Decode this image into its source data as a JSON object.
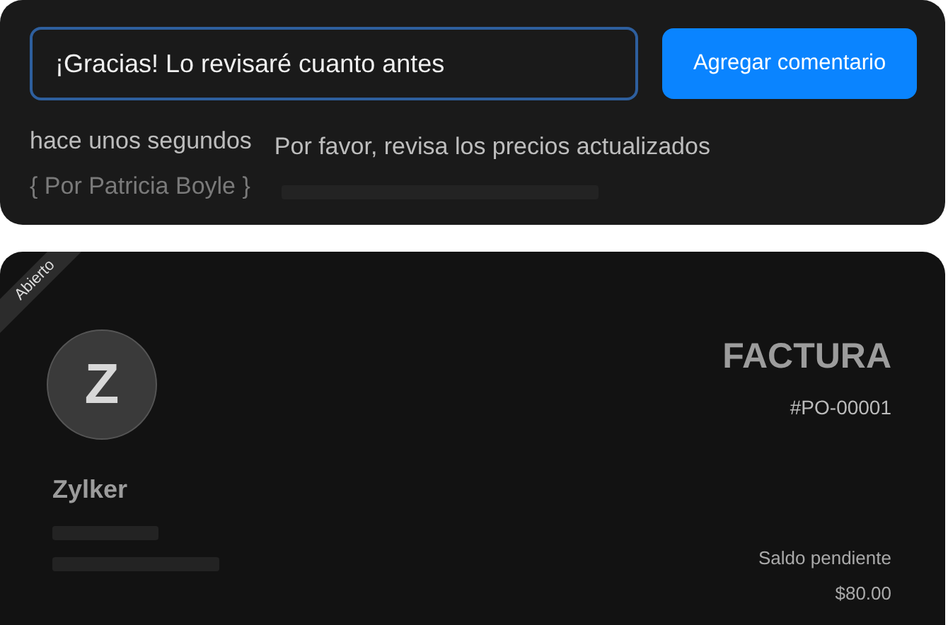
{
  "comment_box": {
    "value": "¡Gracias! Lo revisaré cuanto antes",
    "button": "Agregar comentario"
  },
  "comment": {
    "time": "hace unos segundos",
    "author": "{ Por Patricia Boyle }",
    "text": "Por favor, revisa los precios actualizados"
  },
  "invoice": {
    "status": "Abierto",
    "avatar_letter": "Z",
    "company": "Zylker",
    "title": "FACTURA",
    "number": "#PO-00001",
    "balance_label": "Saldo pendiente",
    "balance": "$80.00"
  }
}
